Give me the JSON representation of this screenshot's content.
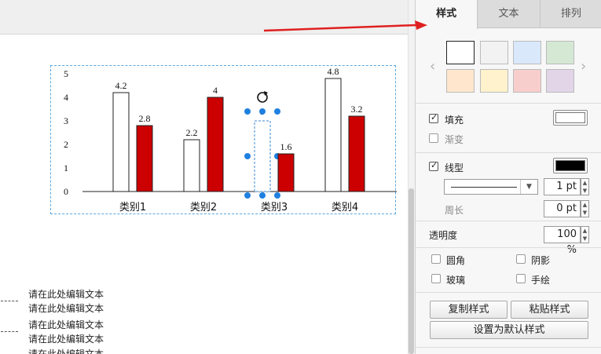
{
  "panel": {
    "tabs": [
      {
        "label": "样式"
      },
      {
        "label": "文本"
      },
      {
        "label": "排列"
      }
    ],
    "nav": {
      "prev": "‹",
      "next": "›"
    },
    "swatches": [
      "#ffffff",
      "#f2f2f2",
      "#dae8fc",
      "#d5e8d4",
      "#ffe6cc",
      "#fff2cc",
      "#f8cecc",
      "#e1d5e7"
    ],
    "fill": {
      "label": "填充",
      "checked": true,
      "color": "#ffffff"
    },
    "gradient": {
      "label": "渐变",
      "checked": false
    },
    "line": {
      "label": "线型",
      "checked": true,
      "color": "#000000",
      "width_value": "1 pt"
    },
    "perimeter": {
      "label": "周长",
      "value": "0 pt"
    },
    "opacity": {
      "label": "透明度",
      "value": "100 %"
    },
    "options": {
      "rounded": "圆角",
      "shadow": "阴影",
      "glass": "玻璃",
      "sketch": "手绘"
    },
    "buttons": {
      "copy_style": "复制样式",
      "paste_style": "粘贴样式",
      "set_default": "设置为默认样式"
    }
  },
  "canvas": {
    "text_blocks": [
      {
        "line1": "请在此处编辑文本",
        "line2": "请在此处编辑文本"
      },
      {
        "line1": "请在此处编辑文本",
        "line2": "请在此处编辑文本"
      },
      {
        "line1": "请在此处编辑文本"
      }
    ]
  },
  "chart_data": {
    "type": "bar",
    "categories": [
      "类别1",
      "类别2",
      "类别3",
      "类别4"
    ],
    "series": [
      {
        "values": [
          4.2,
          2.2,
          3,
          4.8
        ],
        "color": "#ffffff"
      },
      {
        "values": [
          2.8,
          4,
          1.6,
          3.2
        ],
        "color": "#cc0000"
      }
    ],
    "data_labels": [
      [
        "4.2",
        "2.2",
        "",
        "4.8"
      ],
      [
        "2.8",
        "4",
        "1.6",
        "3.2"
      ]
    ],
    "yticks": [
      "0",
      "1",
      "2",
      "3",
      "4",
      "5"
    ],
    "ylim": [
      0,
      5
    ],
    "selected_bar": {
      "series": 0,
      "category": 2,
      "label": "3"
    }
  },
  "annotation": {
    "color": "#e02020"
  }
}
